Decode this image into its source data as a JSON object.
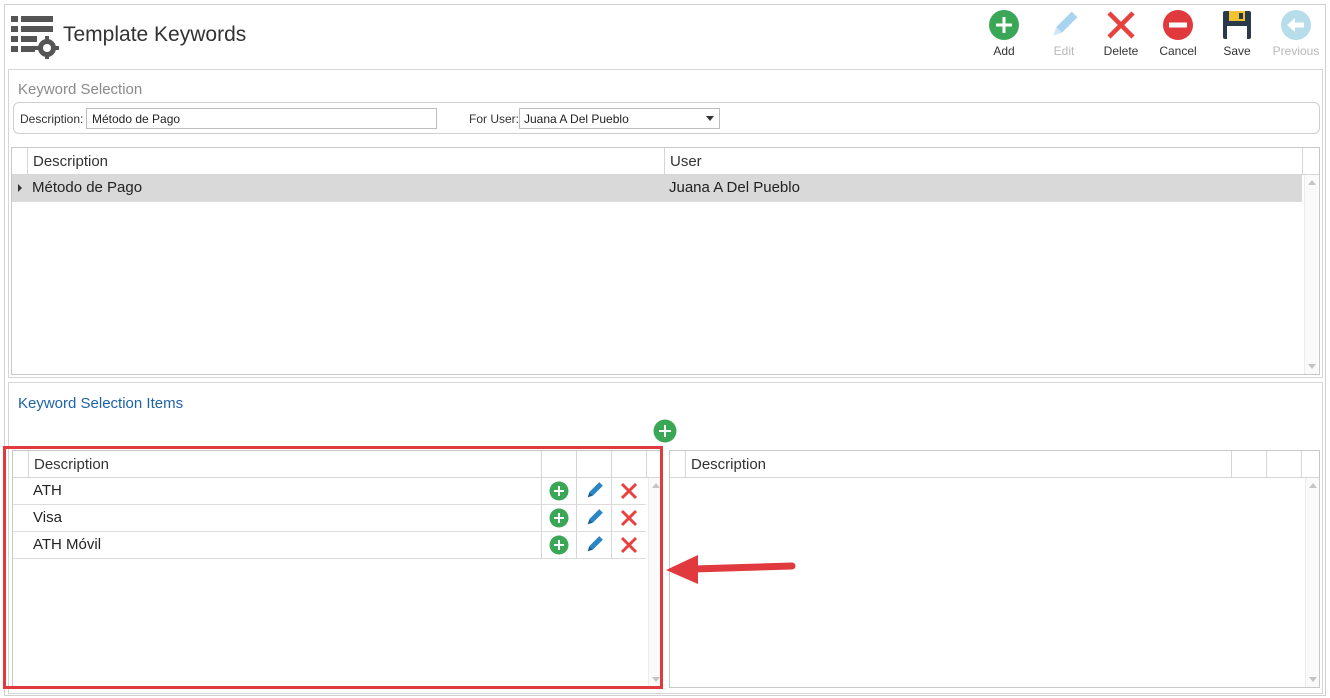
{
  "header": {
    "title": "Template Keywords",
    "toolbar": [
      {
        "id": "add",
        "label": "Add",
        "icon": "add-icon",
        "enabled": true
      },
      {
        "id": "edit",
        "label": "Edit",
        "icon": "pencil-icon",
        "enabled": false
      },
      {
        "id": "delete",
        "label": "Delete",
        "icon": "delete-x-icon",
        "enabled": true
      },
      {
        "id": "cancel",
        "label": "Cancel",
        "icon": "cancel-icon",
        "enabled": true
      },
      {
        "id": "save",
        "label": "Save",
        "icon": "floppy-disk-icon",
        "enabled": true
      },
      {
        "id": "previous",
        "label": "Previous",
        "icon": "back-arrow-icon",
        "enabled": false
      }
    ]
  },
  "keyword_selection": {
    "title": "Keyword Selection",
    "filter": {
      "description_label": "Description:",
      "description_value": "Método de Pago",
      "for_user_label": "For User:",
      "for_user_value": "Juana A Del Pueblo"
    },
    "grid": {
      "columns": [
        "Description",
        "User"
      ],
      "rows": [
        {
          "description": "Método de Pago",
          "user": "Juana A Del Pueblo",
          "selected": true
        }
      ]
    }
  },
  "items": {
    "title": "Keyword Selection Items",
    "left_grid": {
      "columns": [
        "Description"
      ],
      "rows": [
        {
          "description": "ATH"
        },
        {
          "description": "Visa"
        },
        {
          "description": "ATH Móvil"
        }
      ]
    },
    "right_grid": {
      "columns": [
        "Description"
      ],
      "rows": []
    }
  },
  "colors": {
    "add_green": "#3aa757",
    "edit_blue": "#2a86c4",
    "delete_red": "#e8423f",
    "highlight_red": "#e0393e",
    "title_blue": "#1e62a8"
  }
}
